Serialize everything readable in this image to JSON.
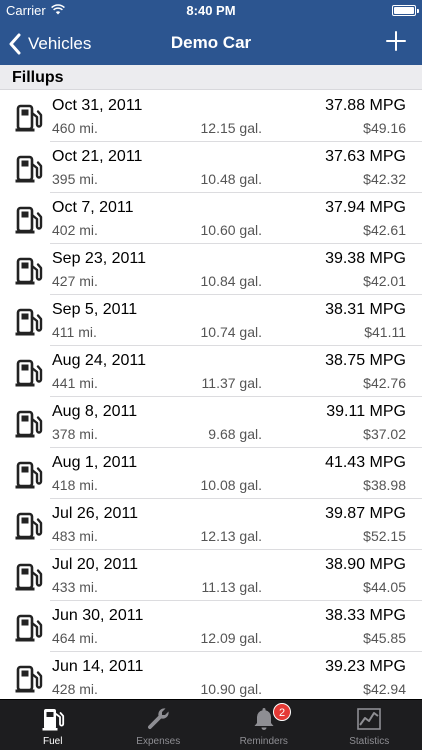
{
  "status_bar": {
    "carrier": "Carrier",
    "time": "8:40 PM"
  },
  "nav": {
    "back_label": "Vehicles",
    "title": "Demo Car"
  },
  "section": {
    "title": "Fillups"
  },
  "fillups": [
    {
      "date": "Oct 31, 2011",
      "mpg": "37.88 MPG",
      "miles": "460 mi.",
      "gallons": "12.15 gal.",
      "cost": "$49.16"
    },
    {
      "date": "Oct 21, 2011",
      "mpg": "37.63 MPG",
      "miles": "395 mi.",
      "gallons": "10.48 gal.",
      "cost": "$42.32"
    },
    {
      "date": "Oct 7, 2011",
      "mpg": "37.94 MPG",
      "miles": "402 mi.",
      "gallons": "10.60 gal.",
      "cost": "$42.61"
    },
    {
      "date": "Sep 23, 2011",
      "mpg": "39.38 MPG",
      "miles": "427 mi.",
      "gallons": "10.84 gal.",
      "cost": "$42.01"
    },
    {
      "date": "Sep 5, 2011",
      "mpg": "38.31 MPG",
      "miles": "411 mi.",
      "gallons": "10.74 gal.",
      "cost": "$41.11"
    },
    {
      "date": "Aug 24, 2011",
      "mpg": "38.75 MPG",
      "miles": "441 mi.",
      "gallons": "11.37 gal.",
      "cost": "$42.76"
    },
    {
      "date": "Aug 8, 2011",
      "mpg": "39.11 MPG",
      "miles": "378 mi.",
      "gallons": "9.68 gal.",
      "cost": "$37.02"
    },
    {
      "date": "Aug 1, 2011",
      "mpg": "41.43 MPG",
      "miles": "418 mi.",
      "gallons": "10.08 gal.",
      "cost": "$38.98"
    },
    {
      "date": "Jul 26, 2011",
      "mpg": "39.87 MPG",
      "miles": "483 mi.",
      "gallons": "12.13 gal.",
      "cost": "$52.15"
    },
    {
      "date": "Jul 20, 2011",
      "mpg": "38.90 MPG",
      "miles": "433 mi.",
      "gallons": "11.13 gal.",
      "cost": "$44.05"
    },
    {
      "date": "Jun 30, 2011",
      "mpg": "38.33 MPG",
      "miles": "464 mi.",
      "gallons": "12.09 gal.",
      "cost": "$45.85"
    },
    {
      "date": "Jun 14, 2011",
      "mpg": "39.23 MPG",
      "miles": "428 mi.",
      "gallons": "10.90 gal.",
      "cost": "$42.94"
    }
  ],
  "tabs": [
    {
      "label": "Fuel",
      "icon": "fuel-pump-icon",
      "active": true
    },
    {
      "label": "Expenses",
      "icon": "wrench-icon",
      "active": false
    },
    {
      "label": "Reminders",
      "icon": "bell-icon",
      "active": false,
      "badge": "2"
    },
    {
      "label": "Statistics",
      "icon": "chart-icon",
      "active": false
    }
  ],
  "colors": {
    "nav_bar": "#2c5590",
    "tab_bar": "#1d1d1f",
    "badge": "#e53935"
  }
}
